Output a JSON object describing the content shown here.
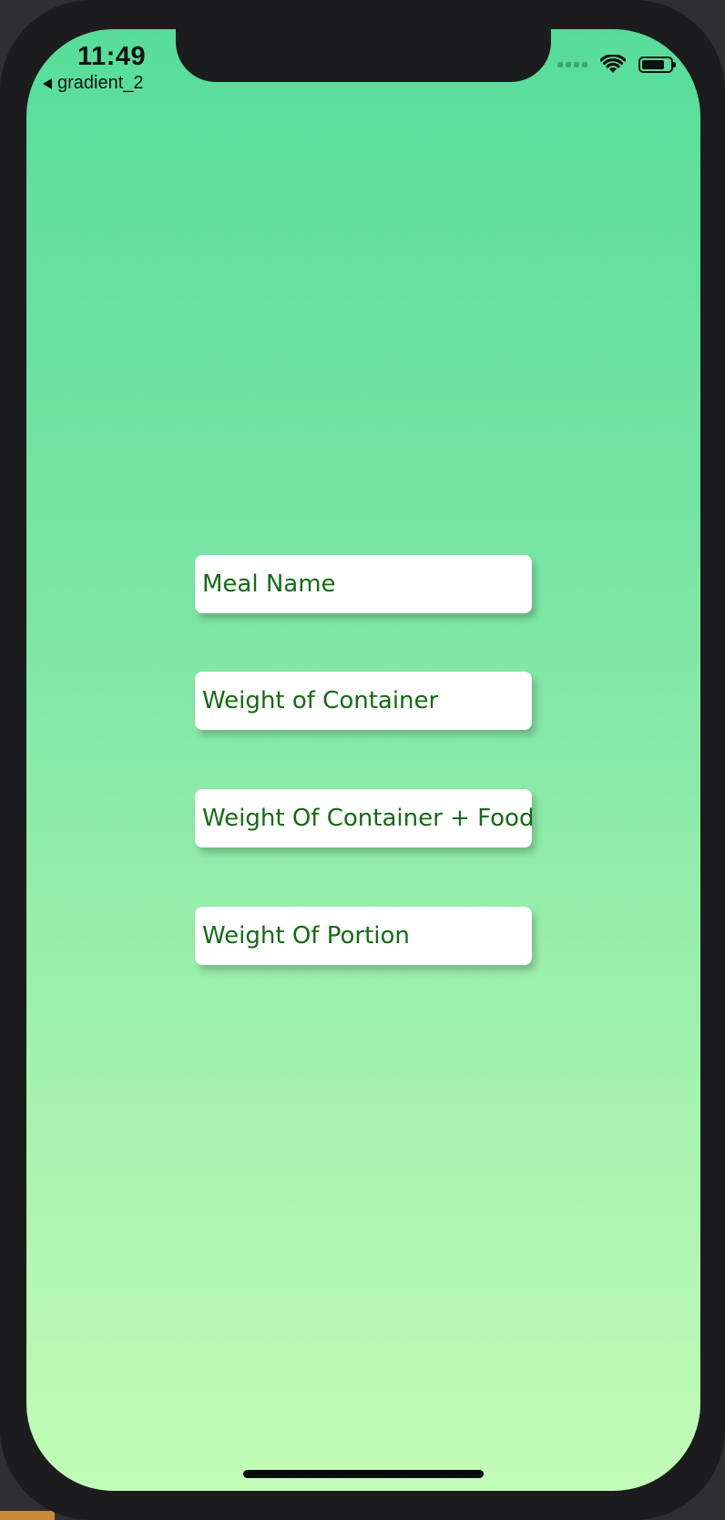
{
  "status_bar": {
    "time": "11:49",
    "back_label": "gradient_2",
    "battery_level": 0.8
  },
  "form": {
    "fields": [
      {
        "placeholder": "Meal Name",
        "value": ""
      },
      {
        "placeholder": "Weight of Container",
        "value": ""
      },
      {
        "placeholder": "Weight Of Container + Food",
        "value": ""
      },
      {
        "placeholder": "Weight Of Portion",
        "value": ""
      }
    ]
  },
  "colors": {
    "gradient_top": "#57dd9a",
    "gradient_bottom": "#c3fdb7",
    "text_accent": "#146b14",
    "field_background": "#ffffff"
  },
  "icons": {
    "back": "back-caret-icon",
    "signal": "cellular-signal-icon",
    "wifi": "wifi-icon",
    "battery": "battery-icon"
  }
}
